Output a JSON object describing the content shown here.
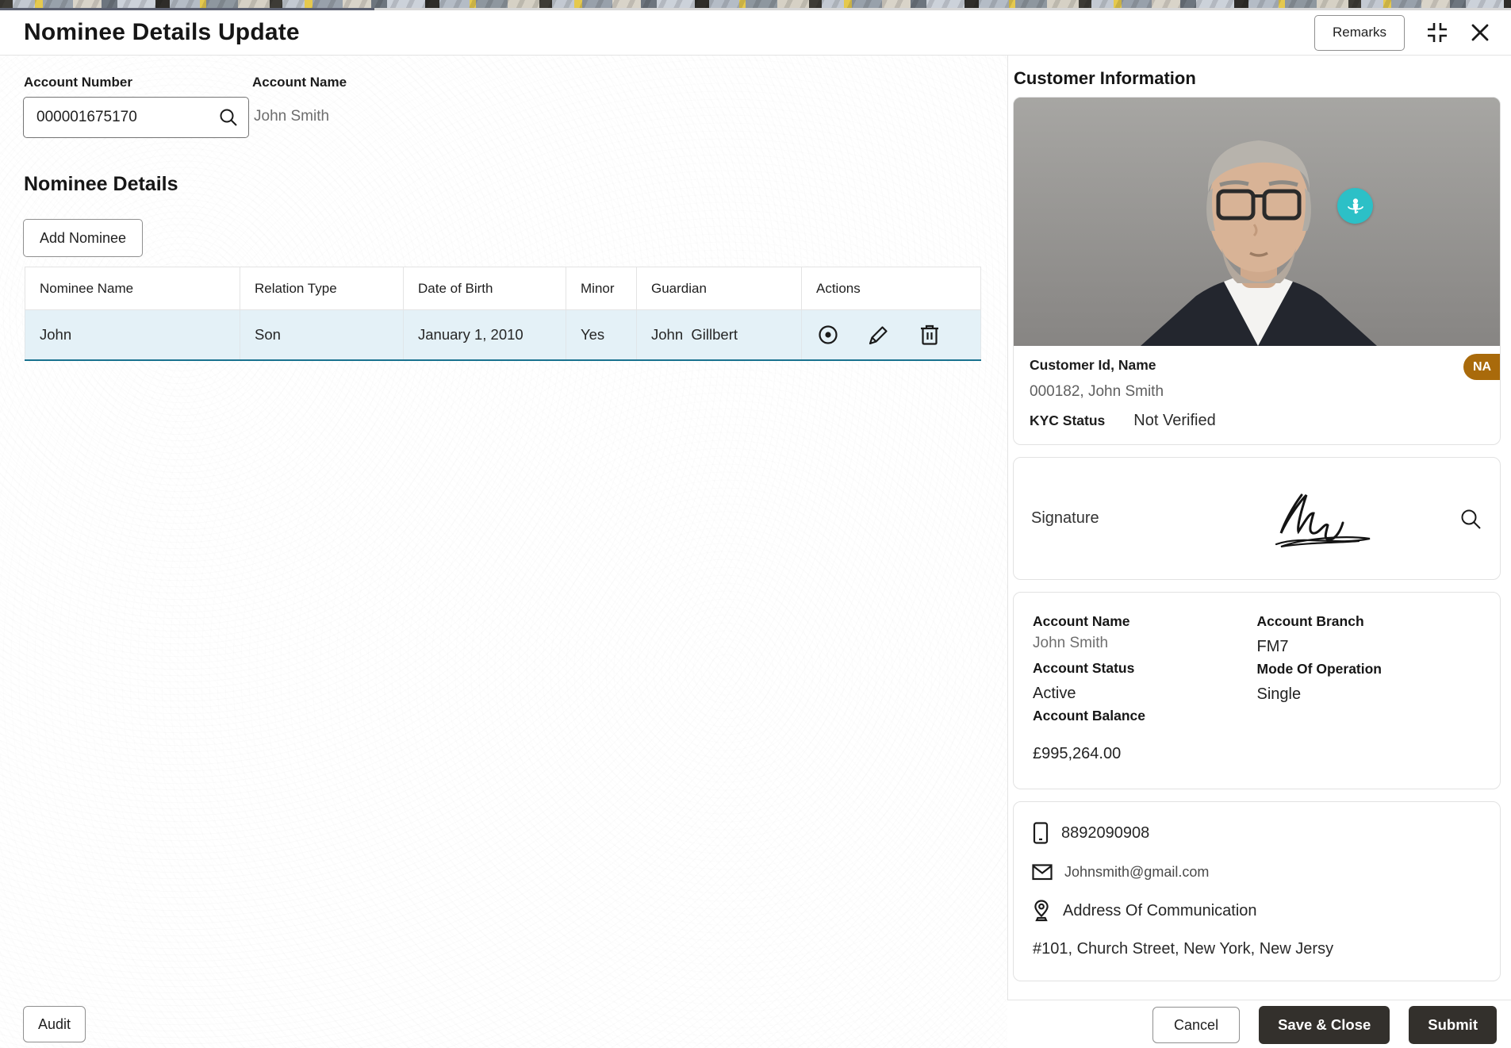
{
  "header": {
    "title": "Nominee Details Update",
    "remarks_label": "Remarks"
  },
  "account": {
    "number_label": "Account Number",
    "number_value": "000001675170",
    "name_label": "Account Name",
    "name_value": "John Smith"
  },
  "nominee": {
    "section_title": "Nominee Details",
    "add_button_label": "Add Nominee",
    "table": {
      "columns": [
        "Nominee Name",
        "Relation Type",
        "Date of Birth",
        "Minor",
        "Guardian",
        "Actions"
      ],
      "rows": [
        {
          "name": "John",
          "relation": "Son",
          "dob": "January 1, 2010",
          "minor": "Yes",
          "guardian": "John  Gillbert"
        }
      ]
    }
  },
  "customer": {
    "panel_title": "Customer Information",
    "id_name_label": "Customer Id, Name",
    "id_name_value": "000182, John Smith",
    "na_badge": "NA",
    "kyc_label": "KYC Status",
    "kyc_value": "Not Verified",
    "signature_label": "Signature",
    "account_name_label": "Account Name",
    "account_name_value": "John Smith",
    "account_branch_label": "Account Branch",
    "account_branch_value": "FM7",
    "account_status_label": "Account Status",
    "account_status_value": "Active",
    "mode_of_operation_label": "Mode Of Operation",
    "mode_of_operation_value": "Single",
    "account_balance_label": "Account Balance",
    "account_balance_value": "£995,264.00",
    "contact": {
      "phone": "8892090908",
      "email": "Johnsmith@gmail.com",
      "address_label": "Address Of Communication",
      "address_value": "#101, Church Street, New York, New Jersy"
    }
  },
  "footer": {
    "audit_label": "Audit",
    "cancel_label": "Cancel",
    "save_close_label": "Save & Close",
    "submit_label": "Submit"
  },
  "colors": {
    "row_highlight": "#e4f1f7",
    "row_border": "#19728f",
    "na_badge_bg": "#a96a0b",
    "badge_360_bg": "#2cc0c7",
    "dark_button_bg": "#33302c"
  }
}
